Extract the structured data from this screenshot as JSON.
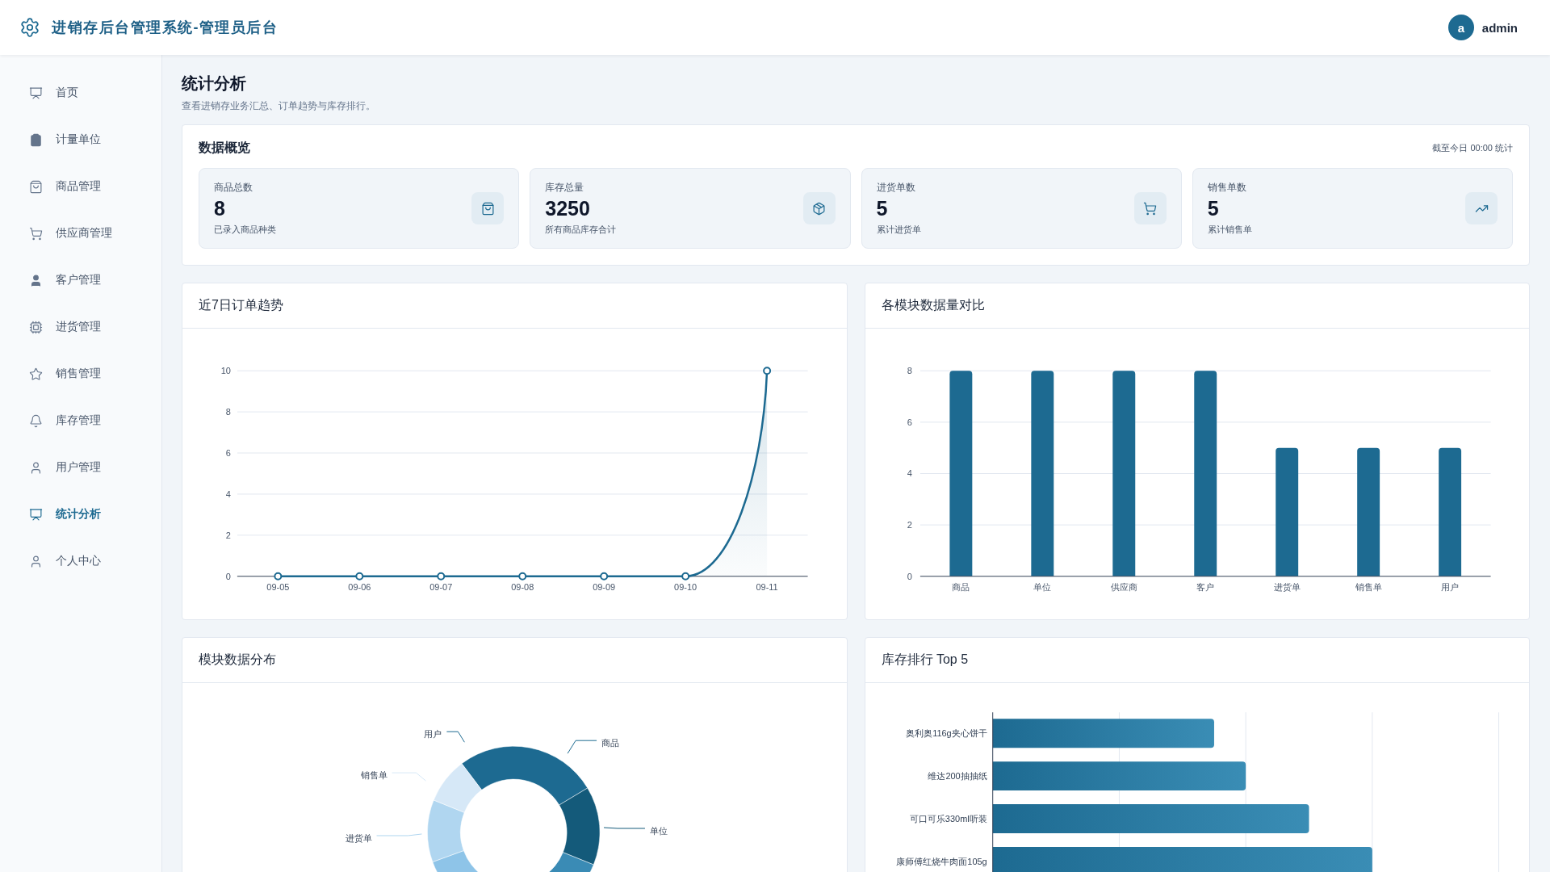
{
  "header": {
    "title": "进销存后台管理系统-管理员后台",
    "avatar": "a",
    "user": "admin"
  },
  "sidebar": {
    "items": [
      {
        "label": "首页",
        "selected": false
      },
      {
        "label": "计量单位",
        "selected": false
      },
      {
        "label": "商品管理",
        "selected": false
      },
      {
        "label": "供应商管理",
        "selected": false
      },
      {
        "label": "客户管理",
        "selected": false
      },
      {
        "label": "进货管理",
        "selected": false
      },
      {
        "label": "销售管理",
        "selected": false
      },
      {
        "label": "库存管理",
        "selected": false
      },
      {
        "label": "用户管理",
        "selected": false
      },
      {
        "label": "统计分析",
        "selected": true
      },
      {
        "label": "个人中心",
        "selected": false
      }
    ]
  },
  "page": {
    "title": "统计分析",
    "subtitle": "查看进销存业务汇总、订单趋势与库存排行。"
  },
  "overview": {
    "title": "数据概览",
    "note": "截至今日 00:00 统计",
    "stats": [
      {
        "label": "商品总数",
        "value": "8",
        "caption": "已录入商品种类"
      },
      {
        "label": "库存总量",
        "value": "3250",
        "caption": "所有商品库存合计"
      },
      {
        "label": "进货单数",
        "value": "5",
        "caption": "累计进货单"
      },
      {
        "label": "销售单数",
        "value": "5",
        "caption": "累计销售单"
      }
    ]
  },
  "trend": {
    "title": "近7日订单趋势",
    "chart_data": {
      "type": "line",
      "categories": [
        "09-05",
        "09-06",
        "09-07",
        "09-08",
        "09-09",
        "09-10",
        "09-11"
      ],
      "series": [
        {
          "color": "#1d6a91",
          "marker": true,
          "values": [
            0,
            0,
            0,
            0,
            0,
            0,
            10
          ]
        }
      ],
      "ylim": [
        0,
        10
      ],
      "yticks": [
        0,
        2,
        4,
        6,
        8,
        10
      ],
      "grid": true
    }
  },
  "compare": {
    "title": "各模块数据量对比",
    "chart_data": {
      "type": "bar",
      "categories": [
        "商品",
        "单位",
        "供应商",
        "客户",
        "进货单",
        "销售单",
        "用户"
      ],
      "series": [
        {
          "color": "#1d6a91",
          "values": [
            8,
            8,
            8,
            8,
            5,
            5,
            5
          ]
        }
      ],
      "ylim": [
        0,
        8
      ],
      "yticks": [
        0,
        2,
        4,
        6,
        8
      ],
      "grid": true
    }
  },
  "distribution": {
    "title": "模块数据分布",
    "labels": [
      "用户",
      "商品",
      "销售单",
      "进货单",
      "单位"
    ]
  },
  "stock_rank": {
    "title": "库存排行 Top 5",
    "items": [
      "奥利奥116g夹心饼干",
      "维达200抽抽纸",
      "可口可乐330ml听装",
      "康师傅红烧牛肉面105g"
    ]
  }
}
